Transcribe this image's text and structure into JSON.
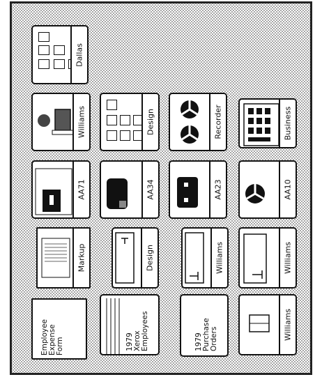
{
  "desktop": {
    "dallas": {
      "label": "Dallas"
    },
    "williams_mailbox": {
      "label": "Williams"
    },
    "design_directory": {
      "label": "Design"
    },
    "recorder": {
      "label": "Recorder"
    },
    "business_calculator": {
      "label": "Business"
    },
    "printers": [
      {
        "label": "AA71"
      },
      {
        "label": "AA34"
      },
      {
        "label": "AA23"
      },
      {
        "label": "AA10"
      }
    ],
    "markup_doc": {
      "label": "Markup"
    },
    "design_folder": {
      "label": "Design"
    },
    "williams_folder_1": {
      "label": "Williams"
    },
    "williams_folder_2": {
      "label": "Williams"
    },
    "expense_form": {
      "label": "Employee\nExpense\nForm"
    },
    "xerox_employees": {
      "label": "1979\nXerox\nEmployees"
    },
    "purchase_orders": {
      "label": "1979\nPurchase\nOrders"
    },
    "williams_record": {
      "label": "Williams"
    }
  },
  "icon_names": [
    "folder-icon",
    "printer-icon",
    "document-icon",
    "mailbox-icon",
    "recorder-icon",
    "calculator-icon"
  ]
}
